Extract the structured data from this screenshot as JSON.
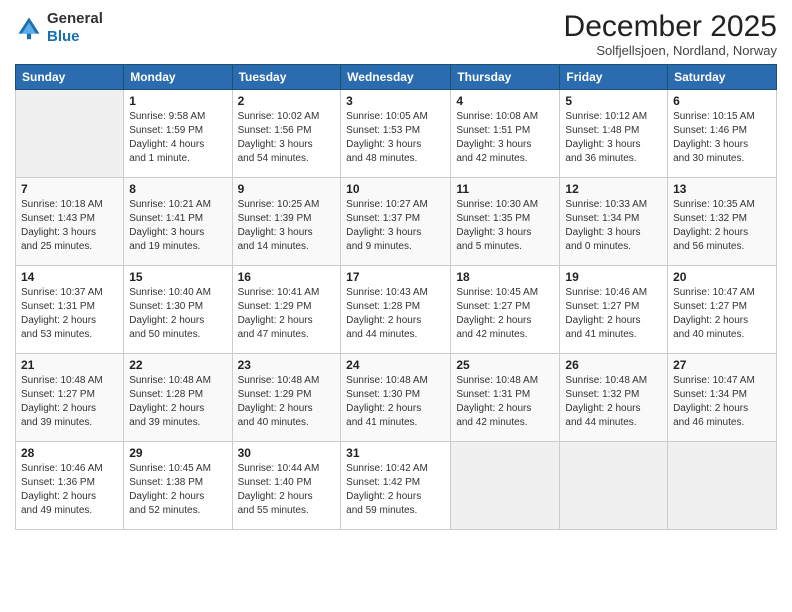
{
  "logo": {
    "general": "General",
    "blue": "Blue"
  },
  "header": {
    "title": "December 2025",
    "subtitle": "Solfjellsjoen, Nordland, Norway"
  },
  "days_of_week": [
    "Sunday",
    "Monday",
    "Tuesday",
    "Wednesday",
    "Thursday",
    "Friday",
    "Saturday"
  ],
  "weeks": [
    [
      {
        "day": "",
        "info": ""
      },
      {
        "day": "1",
        "info": "Sunrise: 9:58 AM\nSunset: 1:59 PM\nDaylight: 4 hours\nand 1 minute."
      },
      {
        "day": "2",
        "info": "Sunrise: 10:02 AM\nSunset: 1:56 PM\nDaylight: 3 hours\nand 54 minutes."
      },
      {
        "day": "3",
        "info": "Sunrise: 10:05 AM\nSunset: 1:53 PM\nDaylight: 3 hours\nand 48 minutes."
      },
      {
        "day": "4",
        "info": "Sunrise: 10:08 AM\nSunset: 1:51 PM\nDaylight: 3 hours\nand 42 minutes."
      },
      {
        "day": "5",
        "info": "Sunrise: 10:12 AM\nSunset: 1:48 PM\nDaylight: 3 hours\nand 36 minutes."
      },
      {
        "day": "6",
        "info": "Sunrise: 10:15 AM\nSunset: 1:46 PM\nDaylight: 3 hours\nand 30 minutes."
      }
    ],
    [
      {
        "day": "7",
        "info": "Sunrise: 10:18 AM\nSunset: 1:43 PM\nDaylight: 3 hours\nand 25 minutes."
      },
      {
        "day": "8",
        "info": "Sunrise: 10:21 AM\nSunset: 1:41 PM\nDaylight: 3 hours\nand 19 minutes."
      },
      {
        "day": "9",
        "info": "Sunrise: 10:25 AM\nSunset: 1:39 PM\nDaylight: 3 hours\nand 14 minutes."
      },
      {
        "day": "10",
        "info": "Sunrise: 10:27 AM\nSunset: 1:37 PM\nDaylight: 3 hours\nand 9 minutes."
      },
      {
        "day": "11",
        "info": "Sunrise: 10:30 AM\nSunset: 1:35 PM\nDaylight: 3 hours\nand 5 minutes."
      },
      {
        "day": "12",
        "info": "Sunrise: 10:33 AM\nSunset: 1:34 PM\nDaylight: 3 hours\nand 0 minutes."
      },
      {
        "day": "13",
        "info": "Sunrise: 10:35 AM\nSunset: 1:32 PM\nDaylight: 2 hours\nand 56 minutes."
      }
    ],
    [
      {
        "day": "14",
        "info": "Sunrise: 10:37 AM\nSunset: 1:31 PM\nDaylight: 2 hours\nand 53 minutes."
      },
      {
        "day": "15",
        "info": "Sunrise: 10:40 AM\nSunset: 1:30 PM\nDaylight: 2 hours\nand 50 minutes."
      },
      {
        "day": "16",
        "info": "Sunrise: 10:41 AM\nSunset: 1:29 PM\nDaylight: 2 hours\nand 47 minutes."
      },
      {
        "day": "17",
        "info": "Sunrise: 10:43 AM\nSunset: 1:28 PM\nDaylight: 2 hours\nand 44 minutes."
      },
      {
        "day": "18",
        "info": "Sunrise: 10:45 AM\nSunset: 1:27 PM\nDaylight: 2 hours\nand 42 minutes."
      },
      {
        "day": "19",
        "info": "Sunrise: 10:46 AM\nSunset: 1:27 PM\nDaylight: 2 hours\nand 41 minutes."
      },
      {
        "day": "20",
        "info": "Sunrise: 10:47 AM\nSunset: 1:27 PM\nDaylight: 2 hours\nand 40 minutes."
      }
    ],
    [
      {
        "day": "21",
        "info": "Sunrise: 10:48 AM\nSunset: 1:27 PM\nDaylight: 2 hours\nand 39 minutes."
      },
      {
        "day": "22",
        "info": "Sunrise: 10:48 AM\nSunset: 1:28 PM\nDaylight: 2 hours\nand 39 minutes."
      },
      {
        "day": "23",
        "info": "Sunrise: 10:48 AM\nSunset: 1:29 PM\nDaylight: 2 hours\nand 40 minutes."
      },
      {
        "day": "24",
        "info": "Sunrise: 10:48 AM\nSunset: 1:30 PM\nDaylight: 2 hours\nand 41 minutes."
      },
      {
        "day": "25",
        "info": "Sunrise: 10:48 AM\nSunset: 1:31 PM\nDaylight: 2 hours\nand 42 minutes."
      },
      {
        "day": "26",
        "info": "Sunrise: 10:48 AM\nSunset: 1:32 PM\nDaylight: 2 hours\nand 44 minutes."
      },
      {
        "day": "27",
        "info": "Sunrise: 10:47 AM\nSunset: 1:34 PM\nDaylight: 2 hours\nand 46 minutes."
      }
    ],
    [
      {
        "day": "28",
        "info": "Sunrise: 10:46 AM\nSunset: 1:36 PM\nDaylight: 2 hours\nand 49 minutes."
      },
      {
        "day": "29",
        "info": "Sunrise: 10:45 AM\nSunset: 1:38 PM\nDaylight: 2 hours\nand 52 minutes."
      },
      {
        "day": "30",
        "info": "Sunrise: 10:44 AM\nSunset: 1:40 PM\nDaylight: 2 hours\nand 55 minutes."
      },
      {
        "day": "31",
        "info": "Sunrise: 10:42 AM\nSunset: 1:42 PM\nDaylight: 2 hours\nand 59 minutes."
      },
      {
        "day": "",
        "info": ""
      },
      {
        "day": "",
        "info": ""
      },
      {
        "day": "",
        "info": ""
      }
    ]
  ]
}
